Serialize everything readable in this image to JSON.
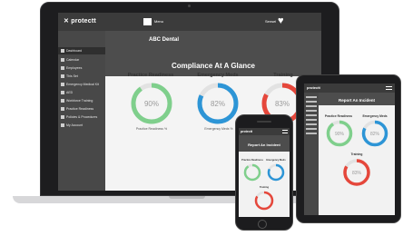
{
  "colors": {
    "green": "#7fcf8c",
    "blue": "#2d95d6",
    "red": "#e5473b",
    "track": "#e2e2e2"
  },
  "laptop": {
    "logo": "protectt",
    "menu_label": "Menu",
    "user_name": "Sensei",
    "practice_name": "ABC Dental",
    "heading": "Compliance At A Glance",
    "sidebar": [
      {
        "label": "Dashboard",
        "icon": "dashboard-icon"
      },
      {
        "label": "Calendar",
        "icon": "calendar-icon"
      },
      {
        "label": "Employees",
        "icon": "employees-icon"
      },
      {
        "label": "This Set",
        "icon": "document-icon"
      },
      {
        "label": "Emergency Medical Kit",
        "icon": "medical-kit-icon"
      },
      {
        "label": "AED",
        "icon": "aed-icon"
      },
      {
        "label": "Workforce Training",
        "icon": "training-icon"
      },
      {
        "label": "Practice Readiness",
        "icon": "checklist-icon"
      },
      {
        "label": "Policies & Procedures",
        "icon": "policy-icon"
      },
      {
        "label": "My Account",
        "icon": "account-icon"
      }
    ],
    "cards": [
      {
        "title": "Practice Readiness",
        "value": "90%",
        "percent": 90,
        "color": "green",
        "sublabel": "Practice Readiness %"
      },
      {
        "title": "Emergency Meds",
        "value": "82%",
        "percent": 82,
        "color": "blue",
        "sublabel": "Emergency Meds %"
      },
      {
        "title": "Training",
        "value": "83%",
        "percent": 83,
        "color": "red",
        "sublabel": ""
      }
    ]
  },
  "tablet": {
    "logo": "protectt",
    "heading": "Report An Incident",
    "cards": [
      {
        "title": "Practice Readiness",
        "value": "90%",
        "percent": 90,
        "color": "green"
      },
      {
        "title": "Emergency Meds",
        "value": "82%",
        "percent": 82,
        "color": "blue"
      },
      {
        "title": "Training",
        "value": "83%",
        "percent": 83,
        "color": "red"
      }
    ]
  },
  "phone": {
    "logo": "protectt",
    "heading": "Report An Incident",
    "cards": [
      {
        "title": "Practice Readiness",
        "percent": 90,
        "color": "green"
      },
      {
        "title": "Emergency Meds",
        "percent": 82,
        "color": "blue"
      },
      {
        "title": "Training",
        "percent": 83,
        "color": "red"
      }
    ]
  }
}
